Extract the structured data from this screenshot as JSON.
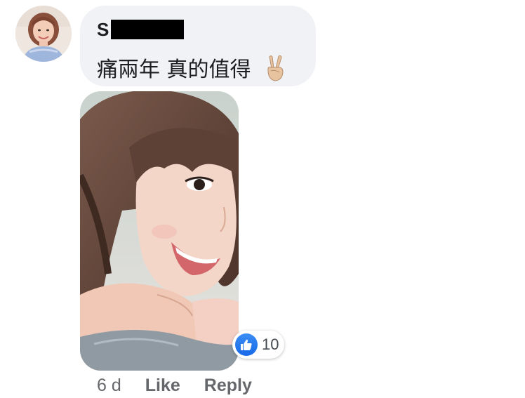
{
  "comment": {
    "author_initial": "S",
    "author_name_redacted": true,
    "text": "痛兩年 真的值得",
    "emoji_icon": "victory-hand-icon",
    "photo_attachment": "selfie-photo"
  },
  "reactions": {
    "icon": "thumbs-up-icon",
    "count": "10",
    "badge_color": "#1877f2"
  },
  "actions": {
    "time": "6 d",
    "like_label": "Like",
    "reply_label": "Reply"
  },
  "colors": {
    "bubble_bg": "#f0f2f5",
    "text": "#1c1e21",
    "muted": "#65676b"
  }
}
